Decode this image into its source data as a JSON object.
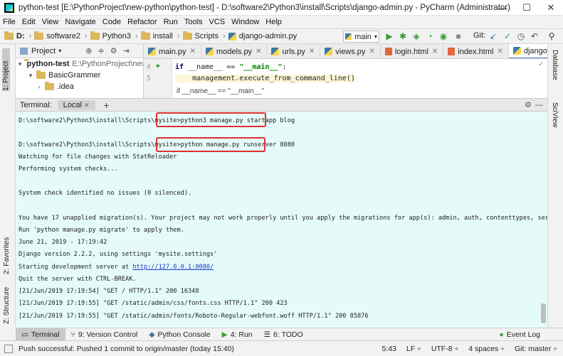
{
  "window": {
    "title": "python-test [E:\\PythonProject\\new-python\\python-test] - D:\\software2\\Python3\\install\\Scripts\\django-admin.py - PyCharm (Administrator)",
    "minimize": "—",
    "maximize": "☐",
    "close": "✕"
  },
  "menu": [
    "File",
    "Edit",
    "View",
    "Navigate",
    "Code",
    "Refactor",
    "Run",
    "Tools",
    "VCS",
    "Window",
    "Help"
  ],
  "breadcrumb": [
    "D:",
    "software2",
    "Python3",
    "install",
    "Scripts",
    "django-admin.py"
  ],
  "toolbar": {
    "run_config": "main",
    "git_label": "Git:"
  },
  "project": {
    "header": "Project",
    "root_name": "python-test",
    "root_path": "E:\\PythonProject\\new-pytho",
    "children": [
      "BasicGrammer",
      ".idea"
    ]
  },
  "editor_tabs": [
    "main.py",
    "models.py",
    "urls.py",
    "views.py",
    "login.html",
    "index.html",
    "django-admin.p"
  ],
  "editor": {
    "lines": [
      {
        "num": "4",
        "code_kw": "if",
        "code_rest": " __name__ == ",
        "code_str": "\"__main__\"",
        "code_end": ":"
      },
      {
        "num": "5",
        "code_plain": "    management.execute_from_command_line()"
      }
    ],
    "breadcrumb_hint": "if __name__ == \"__main__\""
  },
  "terminal": {
    "label": "Terminal:",
    "tab": "Local",
    "lines": [
      "D:\\software2\\Python3\\install\\Scripts\\mysite>python3 manage.py startapp blog",
      "",
      "D:\\software2\\Python3\\install\\Scripts\\mysite>python manage.py runserver 8080",
      "Watching for file changes with StatReloader",
      "Performing system checks...",
      "",
      "System check identified no issues (0 silenced).",
      "",
      "You have 17 unapplied migration(s). Your project may not work properly until you apply the migrations for app(s): admin, auth, contenttypes, sessions.",
      "Run 'python manage.py migrate' to apply them.",
      "June 21, 2019 - 17:19:42",
      "Django version 2.2.2, using settings 'mysite.settings'",
      "Starting development server at ",
      "Quit the server with CTRL-BREAK.",
      "[21/Jun/2019 17:19:54] \"GET / HTTP/1.1\" 200 16348",
      "[21/Jun/2019 17:19:55] \"GET /static/admin/css/fonts.css HTTP/1.1\" 200 423",
      "[21/Jun/2019 17:19:55] \"GET /static/admin/fonts/Roboto-Regular-webfont.woff HTTP/1.1\" 200 85876"
    ],
    "server_url": "http://127.0.0.1:8080/"
  },
  "left_strip": [
    "1: Project",
    "2: Favorites",
    "Z: Structure"
  ],
  "right_strip": [
    "Database",
    "SciView"
  ],
  "bottom_tools": [
    "Terminal",
    "9: Version Control",
    "Python Console",
    "4: Run",
    "6: TODO",
    "Event Log"
  ],
  "status": {
    "message": "Push successful: Pushed 1 commit to origin/master (today 15:40)",
    "position": "5:43",
    "line_sep": "LF ÷",
    "encoding": "UTF-8 ÷",
    "indent": "4 spaces ÷",
    "branch": "Git: master ÷"
  },
  "colors": {
    "terminal_bg": "#e4fbf9",
    "highlight_box": "#e0302f",
    "link": "#1a35c8"
  }
}
